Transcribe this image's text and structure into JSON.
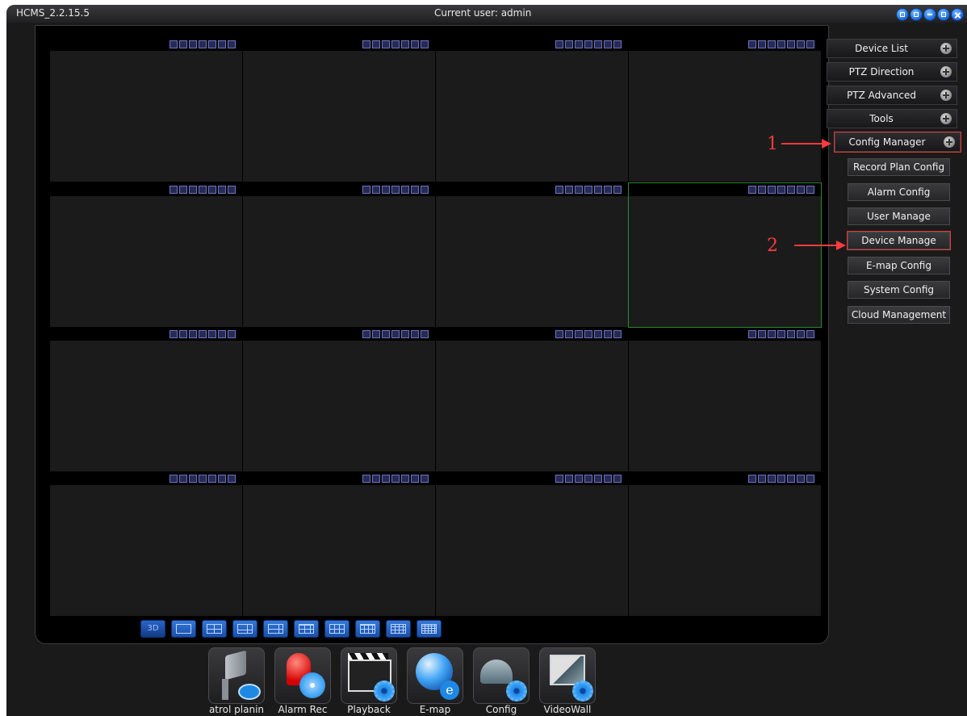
{
  "window": {
    "app_title": "HCMS_2.2.15.5",
    "current_user": "Current user: admin",
    "controls": [
      "lock-icon",
      "list-icon",
      "minimize-icon",
      "restore-icon",
      "close-icon"
    ]
  },
  "sidebar": {
    "menu": [
      {
        "label": "Device List"
      },
      {
        "label": "PTZ Direction"
      },
      {
        "label": "PTZ Advanced"
      },
      {
        "label": "Tools"
      },
      {
        "label": "Config Manager",
        "highlighted": true
      }
    ],
    "submenu": [
      {
        "label": "Record Plan Config"
      },
      {
        "label": "Alarm Config"
      },
      {
        "label": "User Manage"
      },
      {
        "label": "Device Manage",
        "highlighted": true
      },
      {
        "label": "E-map Config"
      },
      {
        "label": "System Config"
      },
      {
        "label": "Cloud Management"
      }
    ]
  },
  "annotations": {
    "one": "1",
    "two": "2"
  },
  "layout_bar": {
    "labels": [
      "3D",
      "",
      "",
      "",
      "",
      "",
      "",
      "",
      "",
      ""
    ]
  },
  "dock": [
    {
      "label": "atrol planin",
      "icon": "patrol-camera-icon"
    },
    {
      "label": "Alarm Rec",
      "icon": "alarm-siren-icon"
    },
    {
      "label": "Playback",
      "icon": "clapperboard-icon"
    },
    {
      "label": "E-map",
      "icon": "globe-icon"
    },
    {
      "label": "Config",
      "icon": "config-gear-icon"
    },
    {
      "label": "VideoWall",
      "icon": "videowall-icon"
    }
  ],
  "colors": {
    "accent": "#1a66d6",
    "highlight": "#e53935",
    "active_cell": "#2b8a2b"
  }
}
